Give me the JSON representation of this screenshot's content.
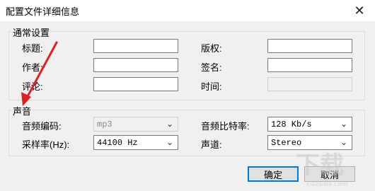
{
  "window": {
    "title": "配置文件详细信息",
    "close_glyph": "✕"
  },
  "general": {
    "legend": "通常设置",
    "title_label": "标题:",
    "author_label": "作者:",
    "comment_label": "评论:",
    "copyright_label": "版权:",
    "signature_label": "签名:",
    "time_label": "时间:"
  },
  "audio": {
    "legend": "声音",
    "codec_label": "音频编码:",
    "codec_value": "mp3",
    "samplerate_label": "采样率(Hz):",
    "samplerate_value": "44100 Hz",
    "bitrate_label": "音频比特率:",
    "bitrate_value": "128 Kb/s",
    "channel_label": "声道:",
    "channel_value": "Stereo"
  },
  "buttons": {
    "ok": "确定",
    "cancel": "取消"
  },
  "watermark": {
    "text": "下载",
    "sub": "xiazaiba.com"
  },
  "colors": {
    "arrow": "#e02020",
    "accent": "#0078d7"
  }
}
